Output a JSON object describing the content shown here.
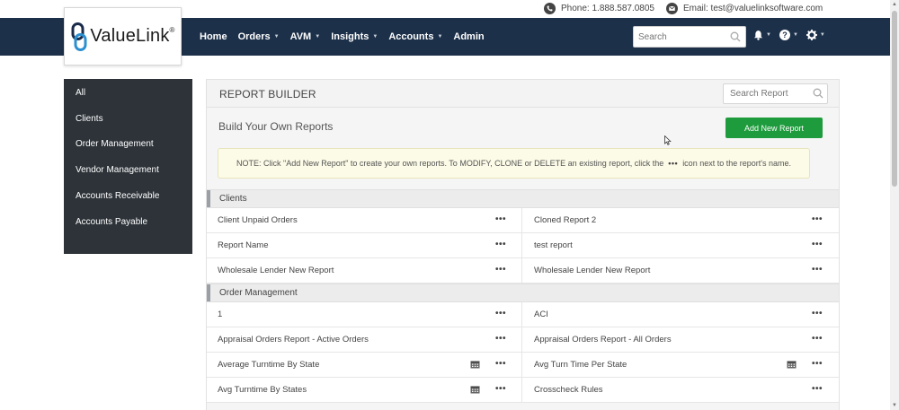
{
  "contact": {
    "phone": "Phone: 1.888.587.0805",
    "email": "Email: test@valuelinksoftware.com"
  },
  "brand": {
    "name": "ValueLink",
    "reg": "®"
  },
  "nav": {
    "items": [
      {
        "label": "Home",
        "dropdown": false
      },
      {
        "label": "Orders",
        "dropdown": true
      },
      {
        "label": "AVM",
        "dropdown": true
      },
      {
        "label": "Insights",
        "dropdown": true
      },
      {
        "label": "Accounts",
        "dropdown": true
      },
      {
        "label": "Admin",
        "dropdown": false
      }
    ],
    "search_placeholder": "Search"
  },
  "sidebar": {
    "items": [
      {
        "label": "All"
      },
      {
        "label": "Clients"
      },
      {
        "label": "Order Management"
      },
      {
        "label": "Vendor Management"
      },
      {
        "label": "Accounts Receivable"
      },
      {
        "label": "Accounts Payable"
      }
    ]
  },
  "main": {
    "title": "REPORT BUILDER",
    "search_placeholder": "Search Report",
    "build_title": "Build Your Own Reports",
    "add_button": "Add New Report",
    "note_before": "NOTE: Click \"Add New Report\" to create your own reports. To MODIFY, CLONE or DELETE an existing report, click the",
    "note_dots": "•••",
    "note_after": "icon next to the report's name."
  },
  "sections": [
    {
      "label": "Clients",
      "rows": [
        {
          "left": {
            "name": "Client Unpaid Orders",
            "cal": false
          },
          "right": {
            "name": "Cloned Report 2",
            "cal": false
          }
        },
        {
          "left": {
            "name": "Report Name",
            "cal": false
          },
          "right": {
            "name": "test report",
            "cal": false
          }
        },
        {
          "left": {
            "name": "Wholesale Lender New Report",
            "cal": false
          },
          "right": {
            "name": "Wholesale Lender New Report",
            "cal": false
          }
        }
      ]
    },
    {
      "label": "Order Management",
      "rows": [
        {
          "left": {
            "name": "1",
            "cal": false
          },
          "right": {
            "name": "ACI",
            "cal": false
          }
        },
        {
          "left": {
            "name": "Appraisal Orders Report - Active Orders",
            "cal": false
          },
          "right": {
            "name": "Appraisal Orders Report - All Orders",
            "cal": false
          }
        },
        {
          "left": {
            "name": "Average Turntime By State",
            "cal": true
          },
          "right": {
            "name": "Avg Turn Time Per State",
            "cal": true
          }
        },
        {
          "left": {
            "name": "Avg Turntime By States",
            "cal": true
          },
          "right": {
            "name": "Crosscheck Rules",
            "cal": false
          }
        }
      ]
    }
  ],
  "row_menu": "•••",
  "colors": {
    "navbar": "#1c3049",
    "sidebar": "#2d3339",
    "add_button": "#1e9b3c",
    "note_bg": "#fcfbe7"
  }
}
